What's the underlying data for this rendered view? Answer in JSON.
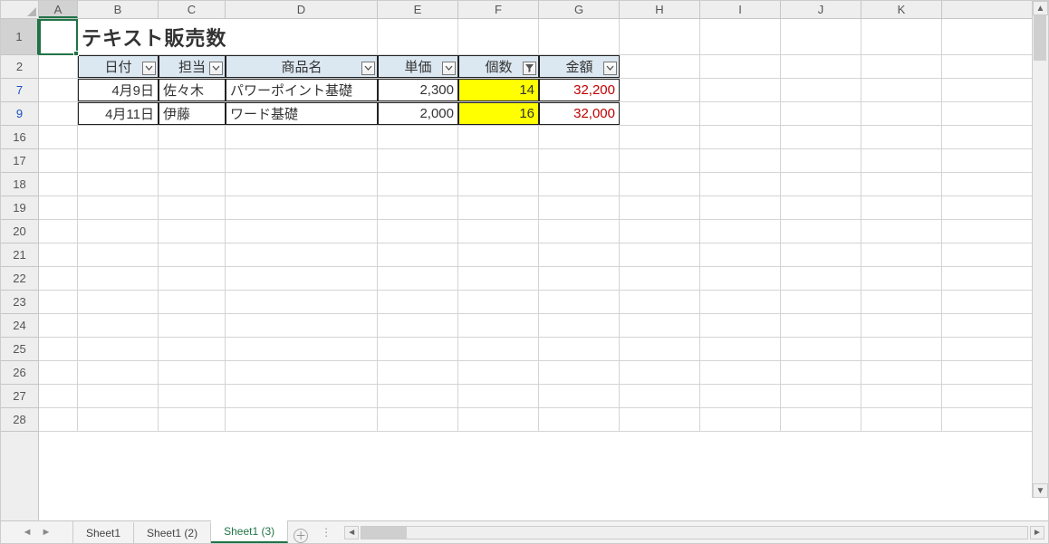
{
  "columns": {
    "A": "A",
    "B": "B",
    "C": "C",
    "D": "D",
    "E": "E",
    "F": "F",
    "G": "G",
    "H": "H",
    "I": "I",
    "J": "J",
    "K": "K"
  },
  "visible_rows": [
    "1",
    "2",
    "7",
    "9",
    "16",
    "17",
    "18",
    "19",
    "20",
    "21",
    "22",
    "23",
    "24",
    "25",
    "26",
    "27",
    "28"
  ],
  "title": "テキスト販売数",
  "table_headers": {
    "date": "日付",
    "rep": "担当",
    "product": "商品名",
    "unit_price": "単価",
    "qty": "個数",
    "amount": "金額"
  },
  "filtered_column": "qty",
  "rows": [
    {
      "row_number": "7",
      "date": "4月9日",
      "rep": "佐々木",
      "product": "パワーポイント基礎",
      "unit_price": "2,300",
      "qty": "14",
      "amount": "32,200"
    },
    {
      "row_number": "9",
      "date": "4月11日",
      "rep": "伊藤",
      "product": "ワード基礎",
      "unit_price": "2,000",
      "qty": "16",
      "amount": "32,000"
    }
  ],
  "sheet_tabs": {
    "t1": "Sheet1",
    "t2": "Sheet1 (2)",
    "t3": "Sheet1 (3)"
  },
  "active_tab": "t3",
  "selected_cell": "A1"
}
